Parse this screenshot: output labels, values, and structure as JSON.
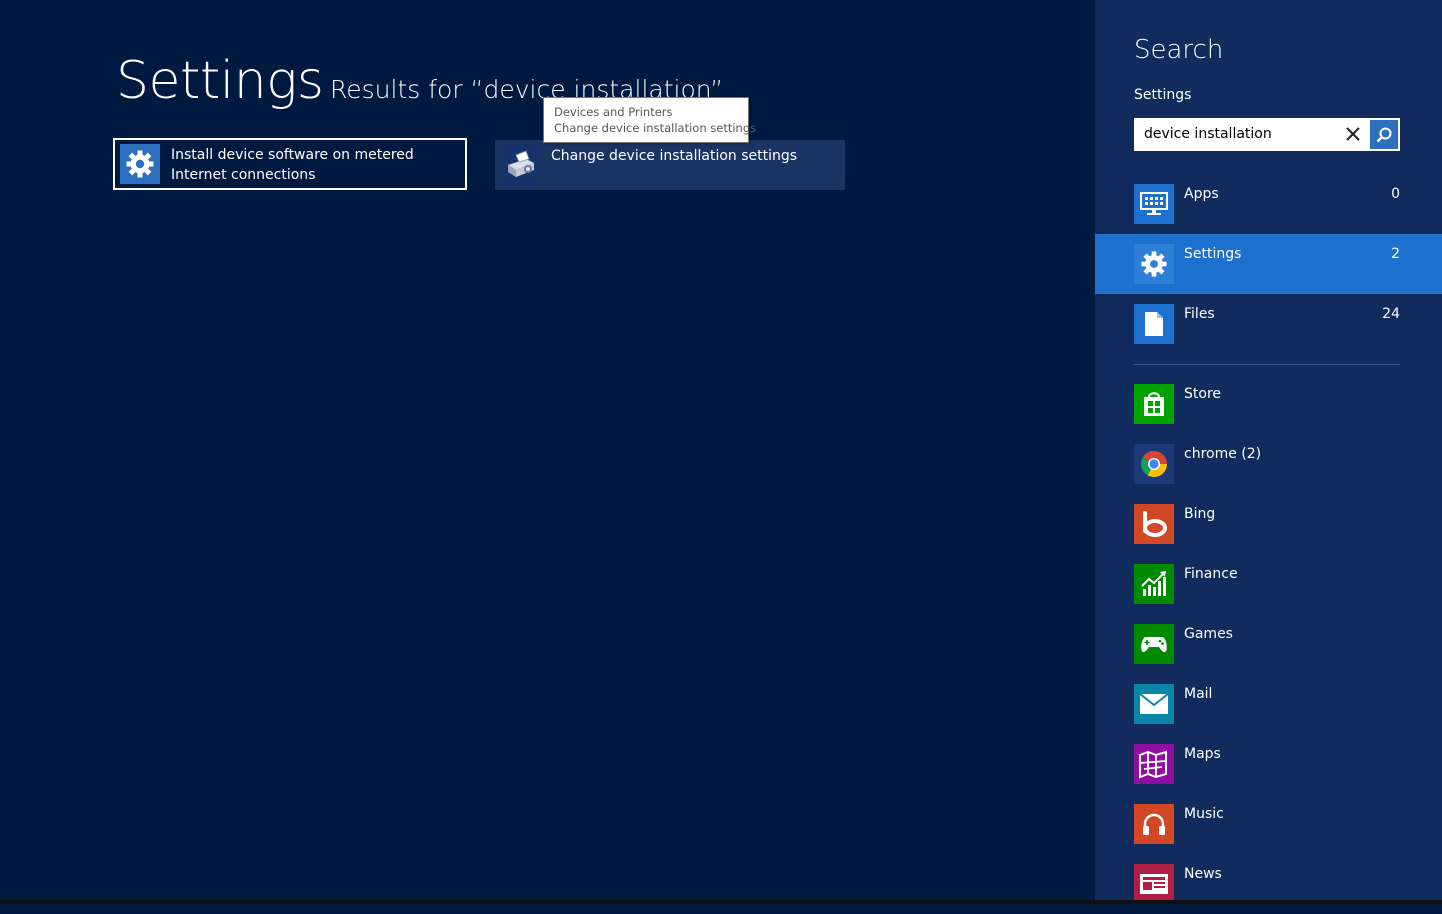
{
  "main": {
    "title": "Settings",
    "results_label": "Results for “device installation”",
    "results": [
      {
        "label": "Install device software on metered Internet connections",
        "icon": "gear-icon"
      },
      {
        "label": "Change device installation settings",
        "icon": "devices-printers-icon"
      }
    ],
    "tooltip": {
      "line1": "Devices and Printers",
      "line2": "Change device installation settings"
    }
  },
  "search_pane": {
    "title": "Search",
    "scope_label": "Settings",
    "query": "device installation",
    "scopes": [
      {
        "label": "Apps",
        "count": "0",
        "icon": "apps-icon"
      },
      {
        "label": "Settings",
        "count": "2",
        "icon": "gear-icon",
        "selected": true
      },
      {
        "label": "Files",
        "count": "24",
        "icon": "file-icon"
      }
    ],
    "apps": [
      {
        "label": "Store",
        "icon": "store-icon",
        "color": "#00a300"
      },
      {
        "label": "chrome (2)",
        "icon": "chrome-icon",
        "color": "#1d3a78"
      },
      {
        "label": "Bing",
        "icon": "bing-icon",
        "color": "#d24726"
      },
      {
        "label": "Finance",
        "icon": "finance-icon",
        "color": "#008a00"
      },
      {
        "label": "Games",
        "icon": "games-icon",
        "color": "#008a00"
      },
      {
        "label": "Mail",
        "icon": "mail-icon",
        "color": "#0a84a8"
      },
      {
        "label": "Maps",
        "icon": "maps-icon",
        "color": "#8f0fa0"
      },
      {
        "label": "Music",
        "icon": "music-icon",
        "color": "#d24726"
      },
      {
        "label": "News",
        "icon": "news-icon",
        "color": "#b01e46"
      }
    ]
  },
  "colors": {
    "background": "#001941",
    "pane_background": "#102b5c",
    "selection": "#1e70cf",
    "accent": "#2f6fc0"
  }
}
